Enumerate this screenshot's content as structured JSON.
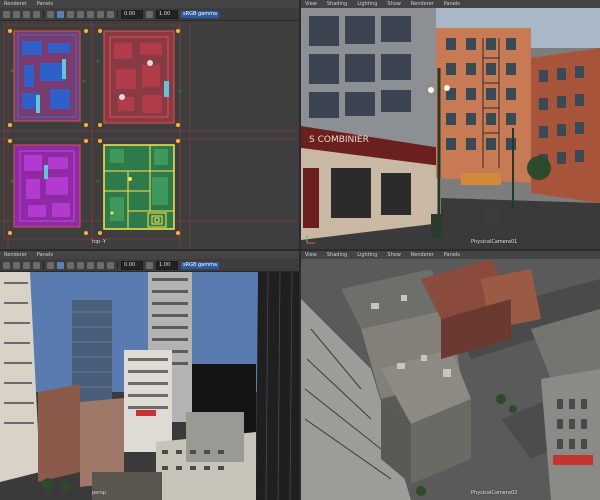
{
  "viewports": {
    "top_left": {
      "menu": [
        "Renderer",
        "Panels"
      ],
      "toolbar": {
        "field1": "0.00",
        "field2": "1.00",
        "colorspace": "sRGB gamma"
      },
      "label": "top -Y"
    },
    "top_right": {
      "menu": [
        "View",
        "Shading",
        "Lighting",
        "Show",
        "Renderer",
        "Panels"
      ],
      "sign_text": "S COMBINIER",
      "label": "PhysicalCamera01"
    },
    "bottom_left": {
      "menu": [
        "Renderer",
        "Panels"
      ],
      "toolbar": {
        "field1": "0.00",
        "field2": "1.00",
        "colorspace": "sRGB gamma"
      },
      "label": "persp"
    },
    "bottom_right": {
      "menu": [
        "View",
        "Shading",
        "Lighting",
        "Show",
        "Renderer",
        "Panels"
      ],
      "label": "PhysicalCamera02"
    }
  },
  "colors": {
    "viewport_bg": "#3c3c3c",
    "plan_grid": "#d23a3a",
    "plan_selected": "#ffe44a",
    "accent": "#2c5aa0"
  },
  "icons": [
    "select-icon",
    "move-icon",
    "rotate-icon",
    "camera-icon",
    "grid-icon",
    "wireframe-icon",
    "shaded-icon",
    "textured-icon",
    "light-icon",
    "isolate-icon",
    "xray-icon",
    "gamma-icon"
  ]
}
